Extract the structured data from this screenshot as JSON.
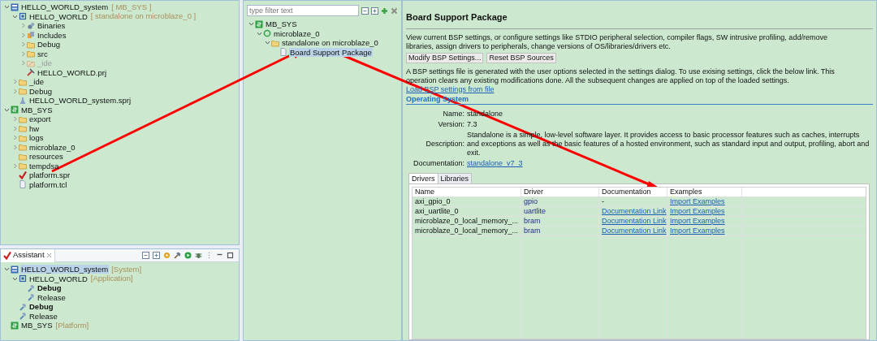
{
  "explorer": {
    "tree": [
      {
        "label": "HELLO_WORLD_system",
        "suffix": "[ MB_SYS ]",
        "kind": "system",
        "expanded": true,
        "selected": false,
        "dimmed": false,
        "children": [
          {
            "label": "HELLO_WORLD",
            "suffix": "[ standalone on microblaze_0 ]",
            "kind": "app",
            "expanded": true,
            "selected": false,
            "dimmed": false,
            "children": [
              {
                "label": "Binaries",
                "kind": "binaries",
                "expanded": false,
                "selected": false,
                "dimmed": false
              },
              {
                "label": "Includes",
                "kind": "includes",
                "expanded": false,
                "selected": false,
                "dimmed": false
              },
              {
                "label": "Debug",
                "kind": "folder",
                "expanded": false,
                "selected": false,
                "dimmed": false
              },
              {
                "label": "src",
                "kind": "folder",
                "expanded": false,
                "selected": false,
                "dimmed": false
              },
              {
                "label": "_ide",
                "kind": "ide",
                "expanded": false,
                "selected": false,
                "dimmed": true
              },
              {
                "label": "HELLO_WORLD.prj",
                "kind": "prj",
                "selected": false,
                "dimmed": false
              }
            ]
          },
          {
            "label": "_ide",
            "kind": "folder",
            "expanded": false,
            "selected": false,
            "dimmed": false
          },
          {
            "label": "Debug",
            "kind": "folder",
            "expanded": false,
            "selected": false,
            "dimmed": false
          },
          {
            "label": "HELLO_WORLD_system.sprj",
            "kind": "sprj",
            "selected": false,
            "dimmed": false
          }
        ]
      },
      {
        "label": "MB_SYS",
        "kind": "platform",
        "expanded": true,
        "selected": false,
        "dimmed": false,
        "children": [
          {
            "label": "export",
            "kind": "folder",
            "expanded": false,
            "selected": false,
            "dimmed": false
          },
          {
            "label": "hw",
            "kind": "folder",
            "expanded": false,
            "selected": false,
            "dimmed": false
          },
          {
            "label": "logs",
            "kind": "folder",
            "expanded": false,
            "selected": false,
            "dimmed": false
          },
          {
            "label": "microblaze_0",
            "kind": "folder",
            "expanded": false,
            "selected": false,
            "dimmed": false
          },
          {
            "label": "resources",
            "kind": "folder",
            "selected": false,
            "dimmed": false
          },
          {
            "label": "tempdsa",
            "kind": "folder",
            "expanded": false,
            "selected": false,
            "dimmed": false
          },
          {
            "label": "platform.spr",
            "kind": "spr",
            "selected": false,
            "dimmed": false
          },
          {
            "label": "platform.tcl",
            "kind": "file",
            "selected": false,
            "dimmed": false
          }
        ]
      }
    ]
  },
  "assistant": {
    "tab": "Assistant",
    "tree": [
      {
        "label": "HELLO_WORLD_system",
        "suffix": "[System]",
        "kind": "system",
        "expanded": true,
        "selected": true,
        "active": false,
        "children": [
          {
            "label": "HELLO_WORLD",
            "suffix": "[Application]",
            "kind": "app",
            "expanded": true,
            "selected": false,
            "active": false,
            "children": [
              {
                "label": "Debug",
                "kind": "config",
                "selected": false,
                "active": true
              },
              {
                "label": "Release",
                "kind": "config",
                "selected": false,
                "active": false
              }
            ]
          },
          {
            "label": "Debug",
            "kind": "config",
            "selected": false,
            "active": true
          },
          {
            "label": "Release",
            "kind": "config",
            "selected": false,
            "active": false
          }
        ]
      },
      {
        "label": "MB_SYS",
        "suffix": "[Platform]",
        "kind": "platform",
        "selected": false,
        "active": false
      }
    ]
  },
  "platform_tree": {
    "filter_placeholder": "type filter text",
    "tree": [
      {
        "label": "MB_SYS",
        "kind": "platform",
        "expanded": true,
        "selected": false,
        "children": [
          {
            "label": "microblaze_0",
            "kind": "processor",
            "expanded": true,
            "selected": false,
            "children": [
              {
                "label": "standalone on microblaze_0",
                "kind": "folder",
                "expanded": true,
                "selected": false,
                "children": [
                  {
                    "label": "Board Support Package",
                    "kind": "file",
                    "selected": true
                  }
                ]
              }
            ]
          }
        ]
      }
    ]
  },
  "bsp": {
    "title": "Board Support Package",
    "intro": "View current BSP settings, or configure settings like STDIO peripheral selection, compiler flags, SW intrusive profiling, add/remove libraries, assign drivers to peripherals, change versions of OS/libraries/drivers etc.",
    "buttons": [
      "Modify BSP Settings...",
      "Reset BSP Sources"
    ],
    "note": "A BSP settings file is generated with the user options selected in the settings dialog. To use exising settings, click the below link. This operation clears any existing modifications done. All the subsequent changes are applied on top of the loaded settings.",
    "load_link": "Load BSP settings from file",
    "section": "Operating System",
    "properties": [
      {
        "label": "Name:",
        "value": "standalone",
        "link": false
      },
      {
        "label": "Version:",
        "value": "7.3",
        "link": false
      },
      {
        "label": "Description:",
        "value": "Standalone is a simple, low-level software layer. It provides access to basic processor features such as caches, interrupts and exceptions as well as the basic features of a hosted environment, such as standard input and output, profiling, abort and exit.",
        "link": false
      },
      {
        "label": "Documentation:",
        "value": "standalone_v7_3",
        "link": true
      }
    ],
    "tabs": [
      {
        "label": "Drivers",
        "selected": true
      },
      {
        "label": "Libraries",
        "selected": false
      }
    ],
    "table": {
      "columns": [
        "Name",
        "Driver",
        "Documentation",
        "Examples"
      ],
      "rows": [
        {
          "name": "axi_gpio_0",
          "driver": "gpio",
          "documentation": {
            "text": "-",
            "link": false
          },
          "examples": "Import Examples"
        },
        {
          "name": "axi_uartlite_0",
          "driver": "uartlite",
          "documentation": {
            "text": "Documentation Link",
            "link": true
          },
          "examples": "Import Examples"
        },
        {
          "name": "microblaze_0_local_memory_...",
          "driver": "bram",
          "documentation": {
            "text": "Documentation Link",
            "link": true
          },
          "examples": "Import Examples"
        },
        {
          "name": "microblaze_0_local_memory_...",
          "driver": "bram",
          "documentation": {
            "text": "Documentation Link",
            "link": true
          },
          "examples": "Import Examples"
        }
      ]
    }
  }
}
